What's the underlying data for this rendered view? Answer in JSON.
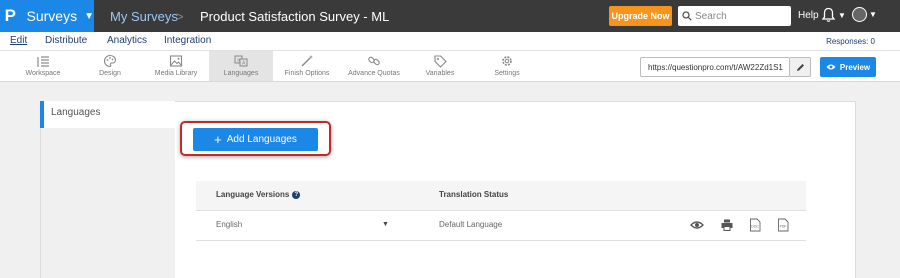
{
  "header": {
    "app_name": "Surveys",
    "breadcrumb_root": "My Surveys",
    "breadcrumb_sep": ">",
    "survey_title": "Product Satisfaction Survey - ML",
    "upgrade_label": "Upgrade Now",
    "search_placeholder": "Search",
    "help_label": "Help"
  },
  "nav": {
    "items": [
      "Edit",
      "Distribute",
      "Analytics",
      "Integration"
    ],
    "active": "Edit",
    "responses": "Responses: 0"
  },
  "toolbar": {
    "items": [
      {
        "label": "Workspace",
        "icon": "workspace-icon"
      },
      {
        "label": "Design",
        "icon": "palette-icon"
      },
      {
        "label": "Media Library",
        "icon": "image-icon"
      },
      {
        "label": "Languages",
        "icon": "translate-icon"
      },
      {
        "label": "Finish Options",
        "icon": "magic-wand-icon"
      },
      {
        "label": "Advance Quotas",
        "icon": "link-icon"
      },
      {
        "label": "Variables",
        "icon": "tag-icon"
      },
      {
        "label": "Settings",
        "icon": "gear-icon"
      }
    ],
    "active": "Languages",
    "survey_url": "https://questionpro.com/t/AW22Zd1S1",
    "preview_label": "Preview"
  },
  "languages": {
    "section_tab": "Languages",
    "add_button": "Add Languages",
    "columns": [
      "Language Versions",
      "Translation Status"
    ],
    "rows": [
      {
        "language": "English",
        "status": "Default Language"
      }
    ]
  },
  "colors": {
    "brand_blue": "#1b87e6",
    "topbar": "#3a3a3a",
    "upgrade": "#f7941d",
    "highlight": "#c62828"
  }
}
